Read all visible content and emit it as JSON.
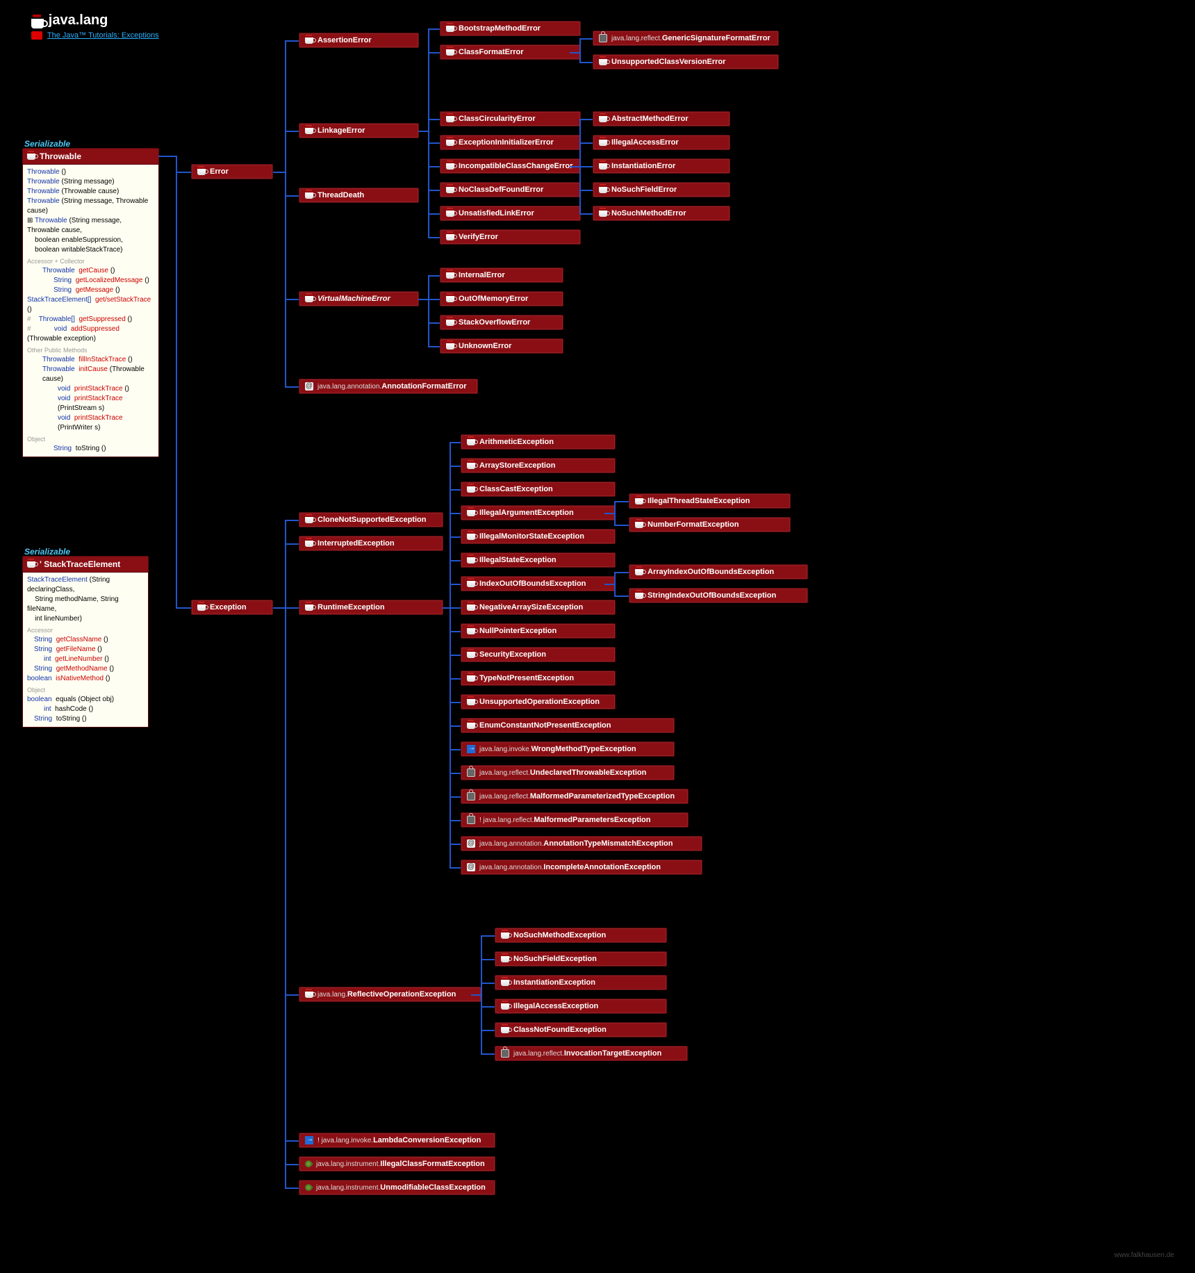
{
  "header": {
    "package": "java.lang",
    "tutorial_label": "The Java™ Tutorials: Exceptions"
  },
  "serializable_label": "Serializable",
  "footer": "www.falkhausen.de",
  "throwable": {
    "title": "Throwable",
    "ctors": [
      "Throwable ()",
      "Throwable (String message)",
      "Throwable (Throwable cause)",
      "Throwable (String message, Throwable cause)",
      "Throwable (String message, Throwable cause,\n    boolean enableSuppression,\n    boolean writableStackTrace)"
    ],
    "acc_label": "Accessor + Collector",
    "accs": [
      {
        "ret": "Throwable",
        "name": "getCause ()"
      },
      {
        "ret": "String",
        "name": "getLocalizedMessage ()"
      },
      {
        "ret": "String",
        "name": "getMessage ()"
      },
      {
        "ret": "StackTraceElement[]",
        "name": "get/setStackTrace ()"
      },
      {
        "ret": "Throwable[]",
        "name": "getSuppressed ()"
      },
      {
        "ret": "void",
        "name": "addSuppressed (Throwable exception)"
      }
    ],
    "other_label": "Other Public Methods",
    "others": [
      {
        "ret": "Throwable",
        "name": "fillInStackTrace ()"
      },
      {
        "ret": "Throwable",
        "name": "initCause (Throwable cause)"
      },
      {
        "ret": "void",
        "name": "printStackTrace ()"
      },
      {
        "ret": "void",
        "name": "printStackTrace (PrintStream s)"
      },
      {
        "ret": "void",
        "name": "printStackTrace (PrintWriter s)"
      }
    ],
    "obj_label": "Object",
    "obj": [
      {
        "ret": "String",
        "name": "toString ()"
      }
    ]
  },
  "ste": {
    "title": "' StackTraceElement",
    "ctor": "StackTraceElement (String declaringClass,\n    String methodName, String fileName,\n    int lineNumber)",
    "acc_label": "Accessor",
    "accs": [
      {
        "ret": "String",
        "name": "getClassName ()"
      },
      {
        "ret": "String",
        "name": "getFileName ()"
      },
      {
        "ret": "int",
        "name": "getLineNumber ()"
      },
      {
        "ret": "String",
        "name": "getMethodName ()"
      },
      {
        "ret": "boolean",
        "name": "isNativeMethod ()"
      }
    ],
    "obj_label": "Object",
    "obj": [
      {
        "ret": "boolean",
        "name": "equals (Object obj)"
      },
      {
        "ret": "int",
        "name": "hashCode ()"
      },
      {
        "ret": "String",
        "name": "toString ()"
      }
    ]
  },
  "nodes": {
    "error": "Error",
    "exception": "Exception",
    "assertion": "AssertionError",
    "linkage": "LinkageError",
    "threaddeath": "ThreadDeath",
    "vmerror": "VirtualMachineError",
    "annoterr": {
      "prefix": "java.lang.annotation.",
      "name": "AnnotationFormatError"
    },
    "bootstrap": "BootstrapMethodError",
    "classformat": "ClassFormatError",
    "gensig": {
      "prefix": "java.lang.reflect.",
      "name": "GenericSignatureFormatError"
    },
    "unsupcls": "UnsupportedClassVersionError",
    "clscirc": "ClassCircularityError",
    "exinit": "ExceptionInInitializerError",
    "incompat": "IncompatibleClassChangeError",
    "nocls": "NoClassDefFoundError",
    "unsat": "UnsatisfiedLinkError",
    "verify": "VerifyError",
    "absmeth": "AbstractMethodError",
    "illacc": "IllegalAccessError",
    "insterr": "InstantiationError",
    "nofield": "NoSuchFieldError",
    "nometh": "NoSuchMethodError",
    "internal": "InternalError",
    "oom": "OutOfMemoryError",
    "stackov": "StackOverflowError",
    "unknown": "UnknownError",
    "clonenot": "CloneNotSupportedException",
    "interrupted": "InterruptedException",
    "runtime": "RuntimeException",
    "reflop": {
      "prefix": "java.lang.",
      "name": "ReflectiveOperationException"
    },
    "lambda": {
      "prefix": "java.lang.invoke.",
      "name": "LambdaConversionException"
    },
    "illclsfmt": {
      "prefix": "java.lang.instrument.",
      "name": "IllegalClassFormatException"
    },
    "unmod": {
      "prefix": "java.lang.instrument.",
      "name": "UnmodifiableClassException"
    },
    "arith": "ArithmeticException",
    "arrstore": "ArrayStoreException",
    "clscast": "ClassCastException",
    "illarg": "IllegalArgumentException",
    "illmon": "IllegalMonitorStateException",
    "illstate": "IllegalStateException",
    "ioob": "IndexOutOfBoundsException",
    "negarr": "NegativeArraySizeException",
    "npe": "NullPointerException",
    "secex": "SecurityException",
    "typenot": "TypeNotPresentException",
    "unsupop": "UnsupportedOperationException",
    "enumnot": "EnumConstantNotPresentException",
    "wrongmeth": {
      "prefix": "java.lang.invoke.",
      "name": "WrongMethodTypeException"
    },
    "undecl": {
      "prefix": "java.lang.reflect.",
      "name": "UndeclaredThrowableException"
    },
    "malfparam": {
      "prefix": "java.lang.reflect.",
      "name": "MalformedParameterizedTypeException"
    },
    "malfparams": {
      "prefix": "! java.lang.reflect.",
      "name": "MalformedParametersException"
    },
    "annotmis": {
      "prefix": "java.lang.annotation.",
      "name": "AnnotationTypeMismatchException"
    },
    "incannot": {
      "prefix": "java.lang.annotation.",
      "name": "IncompleteAnnotationException"
    },
    "illthread": "IllegalThreadStateException",
    "numfmt": "NumberFormatException",
    "arridx": "ArrayIndexOutOfBoundsException",
    "stridx": "StringIndexOutOfBoundsException",
    "nosuchmethex": "NoSuchMethodException",
    "nosuchfieldex": "NoSuchFieldException",
    "instex": "InstantiationException",
    "illaccex": "IllegalAccessException",
    "clsnotfound": "ClassNotFoundException",
    "invtarget": {
      "prefix": "java.lang.reflect.",
      "name": "InvocationTargetException"
    }
  }
}
